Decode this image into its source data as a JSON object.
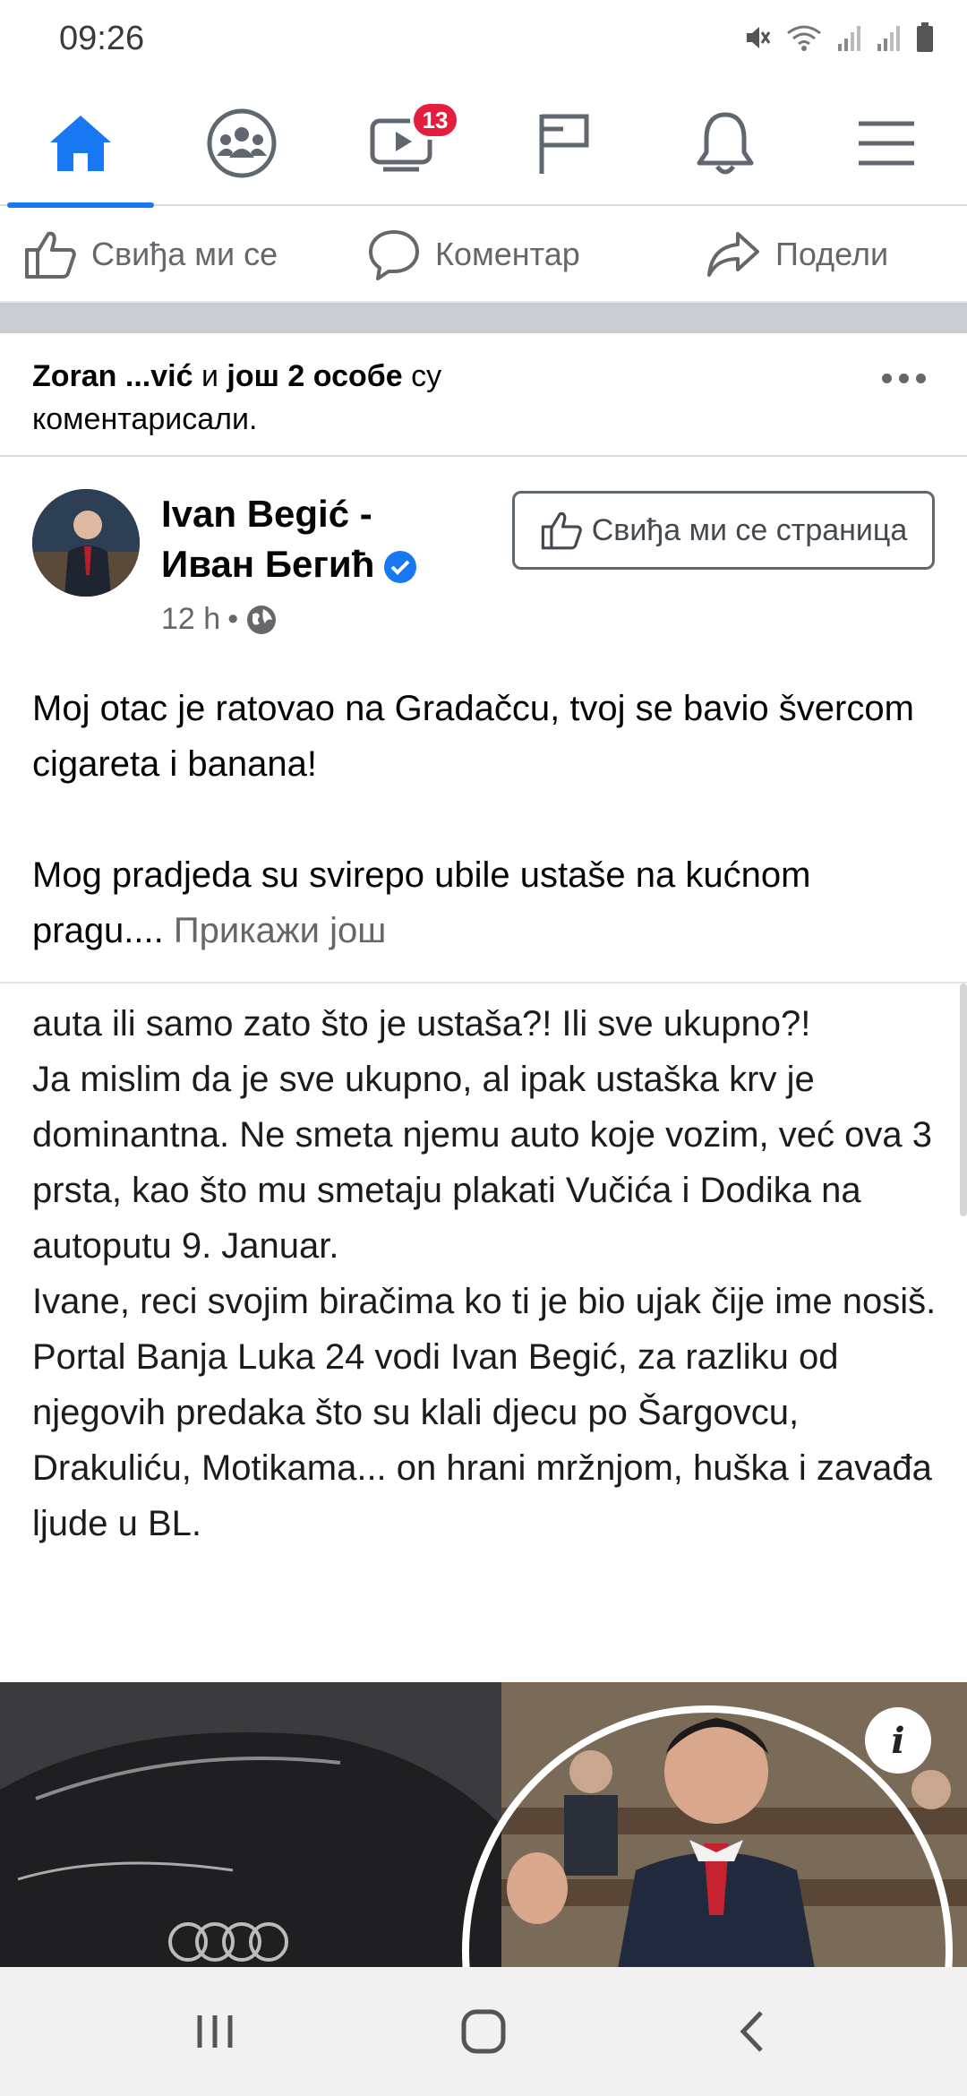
{
  "status_bar": {
    "time": "09:26",
    "icons": [
      "mute-icon",
      "wifi-icon",
      "signal-icon",
      "signal-icon-2",
      "battery-icon"
    ]
  },
  "top_nav": {
    "items": [
      {
        "name": "home",
        "icon": "home-icon",
        "active": true
      },
      {
        "name": "groups",
        "icon": "groups-icon"
      },
      {
        "name": "watch",
        "icon": "video-icon",
        "badge": "13"
      },
      {
        "name": "pages",
        "icon": "flag-icon"
      },
      {
        "name": "notifications",
        "icon": "bell-icon"
      },
      {
        "name": "menu",
        "icon": "hamburger-icon"
      }
    ],
    "accent": "#1877f2",
    "badge_color": "#e41e3f"
  },
  "actions": {
    "like": "Свиђа ми се",
    "comment": "Коментар",
    "share": "Подели"
  },
  "activity": {
    "names": "Zoran ...",
    "names_end": "vić",
    "and": "и",
    "others": "још 2 особе",
    "su": "су",
    "line2": "коментарисали."
  },
  "post": {
    "author_line1": "Ivan Begić -",
    "author_line2": "Иван Бегић",
    "time": "12 h",
    "dot": "•",
    "like_page_label": "Свиђа ми се страница",
    "text_p1": "Moj otac je ratovao na Gradačcu, tvoj se bavio švercom cigareta i banana!",
    "text_p2": "Mog pradjeda su svirepo ubile ustaše na kućnom pragu....",
    "see_more": "Прикажи још"
  },
  "embed": {
    "lines": [
      "auta ili samo zato što je ustaša?! Ili sve ukupno?!",
      "Ja mislim da je sve ukupno, al ipak ustaška krv je dominantna. Ne smeta njemu auto koje vozim, već ova 3 prsta, kao što mu smetaju plakati Vučića i Dodika na autoputu 9. Januar.",
      "Ivane, reci svojim biračima ko ti je bio ujak čije ime nosiš.",
      "Portal Banja Luka 24 vodi Ivan Begić, za razliku od njegovih predaka što su klali djecu po Šargovcu, Drakuliću, Motikama... on hrani mržnjom, huška i zavađa ljude u BL."
    ],
    "info_label": "i"
  },
  "android_nav": {
    "recents": "recents-icon",
    "home": "home-button-icon",
    "back": "back-icon"
  }
}
